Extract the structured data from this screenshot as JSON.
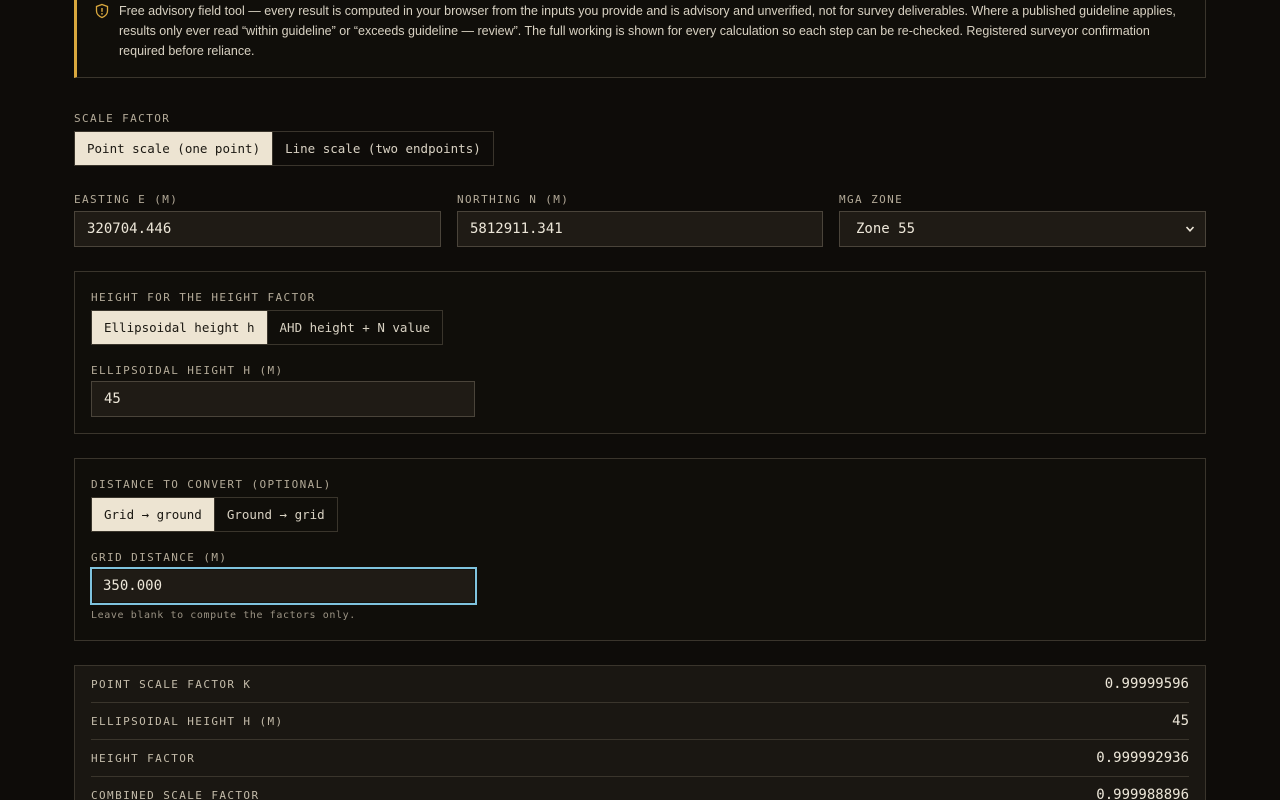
{
  "advisory": {
    "text": "Free advisory field tool — every result is computed in your browser from the inputs you provide and is advisory and unverified, not for survey deliverables. Where a published guideline applies, results only ever read “within guideline” or “exceeds guideline — review”. The full working is shown for every calculation so each step can be re-checked. Registered surveyor confirmation required before reliance."
  },
  "scale_factor": {
    "label": "SCALE FACTOR",
    "options": [
      "Point scale (one point)",
      "Line scale (two endpoints)"
    ],
    "selected": 0
  },
  "inputs": {
    "easting": {
      "label": "EASTING E (M)",
      "value": "320704.446"
    },
    "northing": {
      "label": "NORTHING N (M)",
      "value": "5812911.341"
    },
    "zone": {
      "label": "MGA ZONE",
      "value": "Zone 55"
    }
  },
  "height_panel": {
    "label": "HEIGHT FOR THE HEIGHT FACTOR",
    "options": [
      "Ellipsoidal height h",
      "AHD height + N value"
    ],
    "selected": 0,
    "field_label": "ELLIPSOIDAL HEIGHT H (M)",
    "value": "45"
  },
  "distance_panel": {
    "label": "DISTANCE TO CONVERT (OPTIONAL)",
    "options": [
      "Grid → ground",
      "Ground → grid"
    ],
    "selected": 0,
    "field_label": "GRID DISTANCE (M)",
    "value": "350.000",
    "hint": "Leave blank to compute the factors only."
  },
  "results": [
    {
      "label": "POINT SCALE FACTOR K",
      "value": "0.99999596"
    },
    {
      "label": "ELLIPSOIDAL HEIGHT H (M)",
      "value": "45"
    },
    {
      "label": "HEIGHT FACTOR",
      "value": "0.999992936"
    },
    {
      "label": "COMBINED SCALE FACTOR",
      "value": "0.999988896"
    }
  ],
  "colors": {
    "accent": "#d9a83e",
    "focus": "#7fc3de",
    "active_segment": "#ede4d2"
  }
}
